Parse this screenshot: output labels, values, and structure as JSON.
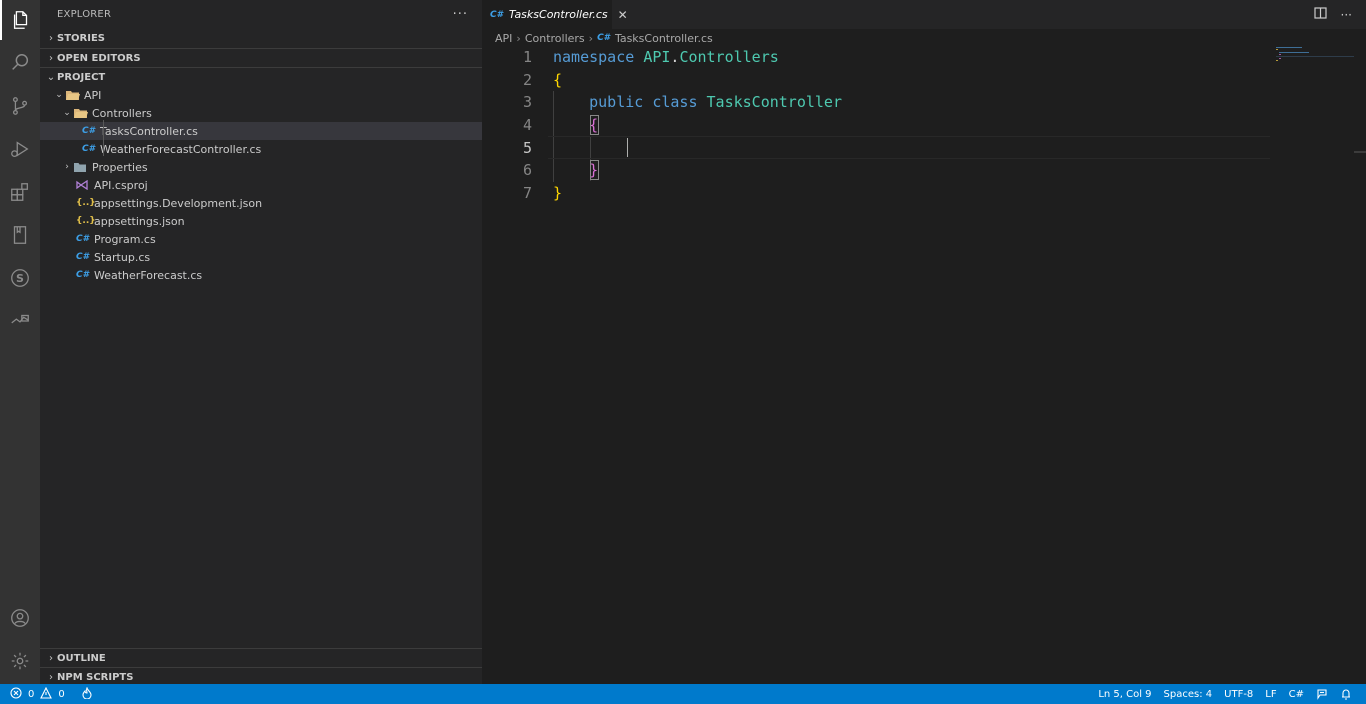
{
  "activity_bar": {
    "icons": [
      "files-icon",
      "search-icon",
      "source-control-icon",
      "run-debug-icon",
      "extensions-icon",
      "book-icon",
      "s-icon",
      "remote-icon",
      "account-icon",
      "gear-icon"
    ]
  },
  "sidebar": {
    "title": "EXPLORER",
    "more": "···",
    "sections": {
      "stories": "STORIES",
      "open_editors": "OPEN EDITORS",
      "project": "PROJECT",
      "outline": "OUTLINE",
      "npm_scripts": "NPM SCRIPTS"
    },
    "tree": [
      {
        "label": "API",
        "type": "folder-open"
      },
      {
        "label": "Controllers",
        "type": "folder-open"
      },
      {
        "label": "TasksController.cs",
        "type": "cs",
        "icon_text": "C#"
      },
      {
        "label": "WeatherForecastController.cs",
        "type": "cs",
        "icon_text": "C#"
      },
      {
        "label": "Properties",
        "type": "folder"
      },
      {
        "label": "API.csproj",
        "type": "proj"
      },
      {
        "label": "appsettings.Development.json",
        "type": "json",
        "icon_text": "{..}"
      },
      {
        "label": "appsettings.json",
        "type": "json",
        "icon_text": "{..}"
      },
      {
        "label": "Program.cs",
        "type": "cs",
        "icon_text": "C#"
      },
      {
        "label": "Startup.cs",
        "type": "cs",
        "icon_text": "C#"
      },
      {
        "label": "WeatherForecast.cs",
        "type": "cs",
        "icon_text": "C#"
      }
    ],
    "selected": "TasksController.cs"
  },
  "editor": {
    "tab": {
      "icon_text": "C#",
      "label": "TasksController.cs",
      "close": "✕"
    },
    "breadcrumb": {
      "parts": [
        "API",
        "Controllers"
      ],
      "file_icon": "C#",
      "file": "TasksController.cs"
    },
    "lines": [
      {
        "num": "1",
        "tokens": [
          {
            "t": "namespace ",
            "c": "kw"
          },
          {
            "t": "API",
            "c": "ns"
          },
          {
            "t": ".",
            "c": "pun"
          },
          {
            "t": "Controllers",
            "c": "ns"
          }
        ]
      },
      {
        "num": "2",
        "tokens": [
          {
            "t": "{",
            "c": "br1"
          }
        ]
      },
      {
        "num": "3",
        "tokens": [
          {
            "t": "    public ",
            "c": "kw"
          },
          {
            "t": "class ",
            "c": "kw"
          },
          {
            "t": "TasksController",
            "c": "cls"
          }
        ]
      },
      {
        "num": "4",
        "tokens": [
          {
            "t": "    {",
            "c": "br2"
          }
        ]
      },
      {
        "num": "5",
        "tokens": []
      },
      {
        "num": "6",
        "tokens": [
          {
            "t": "    }",
            "c": "br2"
          }
        ]
      },
      {
        "num": "7",
        "tokens": [
          {
            "t": "}",
            "c": "br1"
          }
        ]
      }
    ],
    "current_line": 5
  },
  "statusbar": {
    "errors": "0",
    "warnings": "0",
    "position": "Ln 5, Col 9",
    "spaces": "Spaces: 4",
    "encoding": "UTF-8",
    "eol": "LF",
    "language": "C#"
  },
  "colors": {
    "statusbar_bg": "#007acc",
    "activity_bg": "#333333",
    "sidebar_bg": "#252526",
    "editor_bg": "#1e1e1e"
  }
}
